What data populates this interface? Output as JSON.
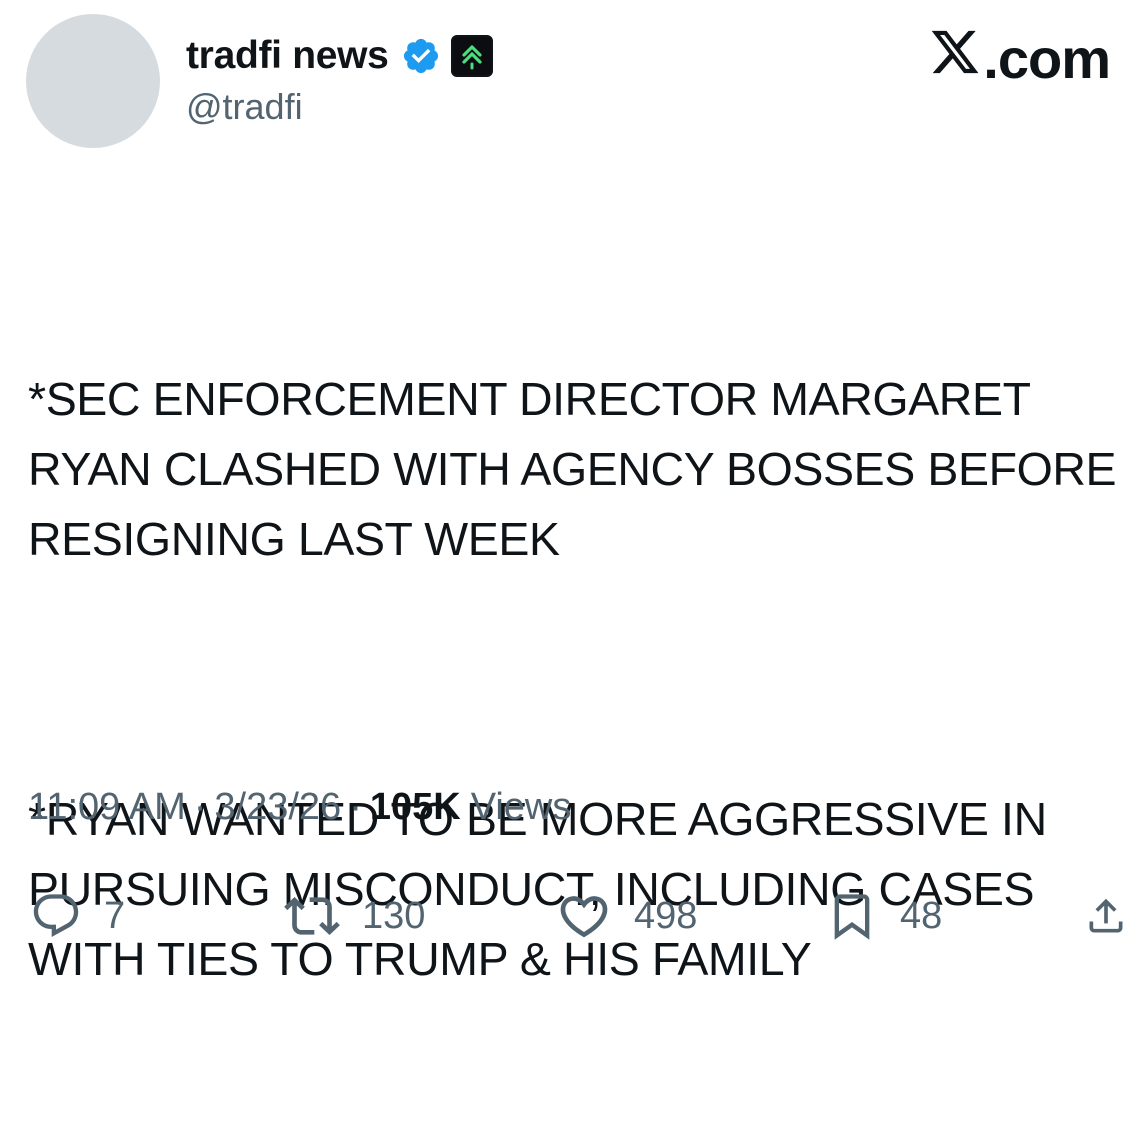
{
  "author": {
    "display_name": "tradfi news",
    "handle": "@tradfi",
    "verified_badge_icon": "verified-check-icon",
    "affiliate_badge_icon": "double-chevron-up-icon",
    "colors": {
      "verified_blue": "#1d9bf0",
      "affiliate_green": "#4ade80"
    }
  },
  "brand": {
    "label": ".com",
    "icon": "x-logo-icon"
  },
  "tweet": {
    "paragraphs": [
      "*SEC ENFORCEMENT DIRECTOR MARGARET RYAN CLASHED WITH AGENCY BOSSES BEFORE RESIGNING LAST WEEK",
      "*RYAN WANTED TO BE MORE AGGRESSIVE IN PURSUING MISCONDUCT, INCLUDING CASES WITH TIES TO TRUMP & HIS FAMILY"
    ]
  },
  "meta": {
    "time": "11:09 AM",
    "separator": "·",
    "date": "3/23/26",
    "views_count": "105K",
    "views_label": "Views"
  },
  "actions": {
    "reply": {
      "icon": "reply-bubble-icon",
      "count": "7"
    },
    "retweet": {
      "icon": "retweet-icon",
      "count": "130"
    },
    "like": {
      "icon": "heart-icon",
      "count": "498"
    },
    "bookmark": {
      "icon": "bookmark-icon",
      "count": "48"
    },
    "share": {
      "icon": "share-icon"
    }
  },
  "colors": {
    "text_primary": "#0f1419",
    "text_secondary": "#536471",
    "avatar_placeholder": "#d5dbdf"
  }
}
